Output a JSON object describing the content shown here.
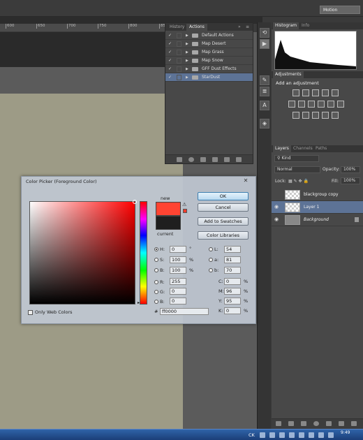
{
  "topbar": {
    "workspace": "Motion"
  },
  "ruler": {
    "ticks": [
      "600",
      "650",
      "700",
      "750",
      "800",
      "850"
    ]
  },
  "actions_panel": {
    "tabs": [
      "History",
      "Actions"
    ],
    "menu_glyph": "»",
    "items": [
      {
        "label": "Default Actions",
        "checked": true
      },
      {
        "label": "Map Desert",
        "checked": true
      },
      {
        "label": "Map Grass",
        "checked": true
      },
      {
        "label": "Map Snow",
        "checked": true
      },
      {
        "label": "GFF Dust Effects",
        "checked": true
      },
      {
        "label": "StarDust",
        "checked": true,
        "selected": true
      }
    ]
  },
  "histogram": {
    "tabs": [
      "Histogram",
      "Info"
    ]
  },
  "adjustments": {
    "tab": "Adjustments",
    "heading": "Add an adjustment"
  },
  "layers": {
    "tabs": [
      "Layers",
      "Channels",
      "Paths"
    ],
    "filter": "Kind",
    "blend_mode": "Normal",
    "opacity_label": "Opacity:",
    "opacity_value": "100%",
    "lock_label": "Lock:",
    "fill_label": "Fill:",
    "fill_value": "100%",
    "items": [
      {
        "name": "blackgroup copy",
        "visible": false,
        "selected": false
      },
      {
        "name": "Layer 1",
        "visible": true,
        "selected": true
      },
      {
        "name": "Background",
        "visible": true,
        "selected": false,
        "locked": true
      }
    ]
  },
  "color_picker": {
    "title": "Color Picker (Foreground Color)",
    "close": "✕",
    "new_label": "new",
    "current_label": "current",
    "new_color": "#ff4432",
    "current_color": "#1f1f1f",
    "buttons": [
      "OK",
      "Cancel",
      "Add to Swatches",
      "Color Libraries"
    ],
    "hsb": [
      {
        "label": "H:",
        "value": "0",
        "unit": "°"
      },
      {
        "label": "S:",
        "value": "100",
        "unit": "%"
      },
      {
        "label": "B:",
        "value": "100",
        "unit": "%"
      }
    ],
    "rgb": [
      {
        "label": "R:",
        "value": "255"
      },
      {
        "label": "G:",
        "value": "0"
      },
      {
        "label": "B:",
        "value": "0"
      }
    ],
    "lab": [
      {
        "label": "L:",
        "value": "54"
      },
      {
        "label": "a:",
        "value": "81"
      },
      {
        "label": "b:",
        "value": "70"
      }
    ],
    "cmyk": [
      {
        "label": "C:",
        "value": "0",
        "unit": "%"
      },
      {
        "label": "M:",
        "value": "96",
        "unit": "%"
      },
      {
        "label": "Y:",
        "value": "95",
        "unit": "%"
      },
      {
        "label": "K:",
        "value": "0",
        "unit": "%"
      }
    ],
    "hex_label": "#",
    "hex": "ff0000",
    "only_web_colors": "Only Web Colors"
  },
  "taskbar": {
    "tray": "CK",
    "time": "9:49"
  },
  "colors": {
    "selection": "#5d7396",
    "panel": "#484848",
    "taskbar": "#1b3e78"
  }
}
